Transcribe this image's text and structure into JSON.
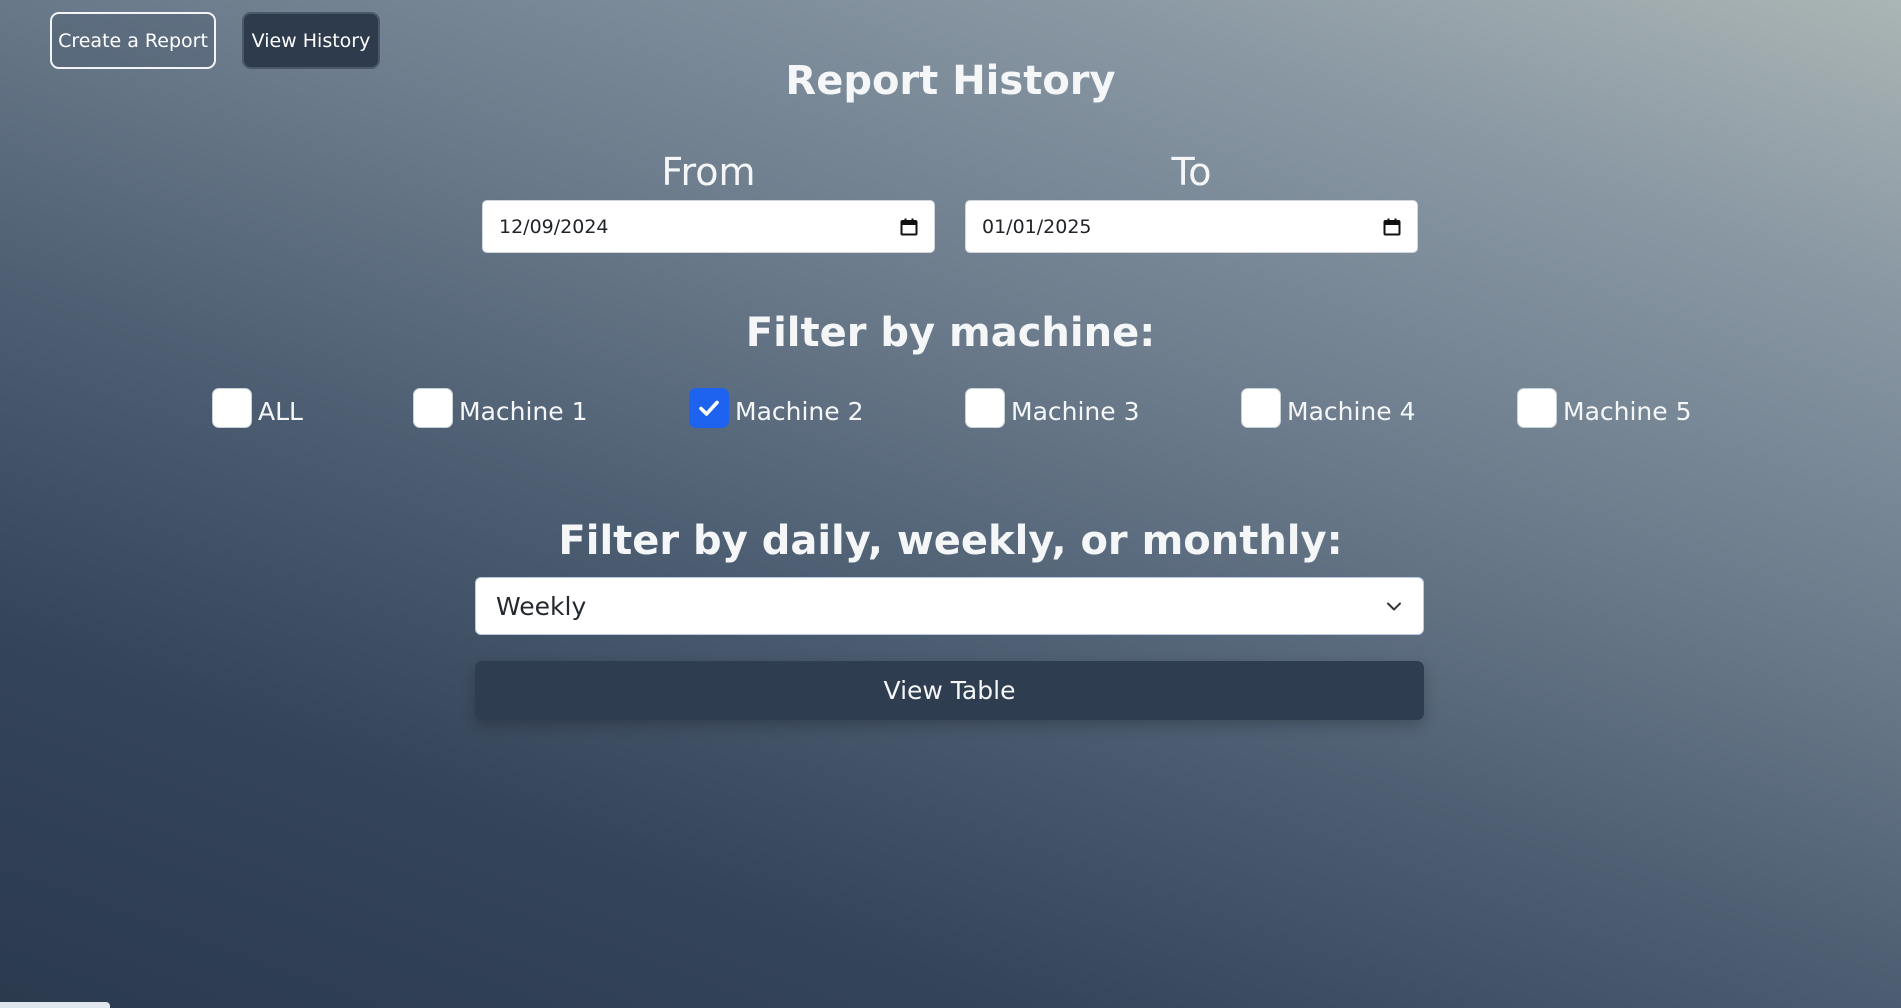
{
  "nav": {
    "create_label": "Create a Report",
    "history_label": "View History"
  },
  "page": {
    "title": "Report History"
  },
  "date_range": {
    "from_label": "From",
    "from_value": "12/09/2024",
    "to_label": "To",
    "to_value": "01/01/2025"
  },
  "machine_filter": {
    "title": "Filter by machine:",
    "options": [
      {
        "label": "ALL",
        "checked": false
      },
      {
        "label": "Machine 1",
        "checked": false
      },
      {
        "label": "Machine 2",
        "checked": true
      },
      {
        "label": "Machine 3",
        "checked": false
      },
      {
        "label": "Machine 4",
        "checked": false
      },
      {
        "label": "Machine 5",
        "checked": false
      }
    ]
  },
  "period_filter": {
    "title": "Filter by daily, weekly, or monthly:",
    "selected": "Weekly"
  },
  "actions": {
    "view_table_label": "View Table"
  },
  "icons": {
    "date_picker": "calendar-icon",
    "dropdown": "chevron-down-icon",
    "checked": "checkmark-icon"
  },
  "colors": {
    "checkbox_checked": "#1e63f0",
    "button_dark": "#2e3d4f"
  }
}
